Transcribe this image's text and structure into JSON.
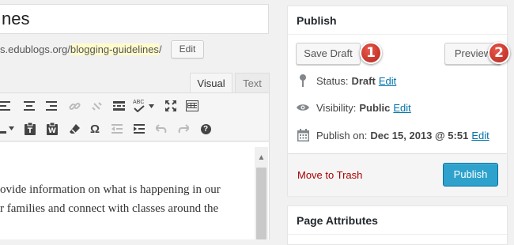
{
  "editor": {
    "title_value": "nes",
    "permalink_prefix": "s.edublogs.org/",
    "permalink_slug": "blogging-guidelines",
    "permalink_suffix": "/",
    "edit_slug_label": "Edit",
    "tabs": [
      {
        "label": "Visual",
        "active": true
      },
      {
        "label": "Text",
        "active": false
      }
    ],
    "toolbar_row1": [
      "align-left-icon",
      "align-center-icon",
      "align-right-icon",
      "link-icon",
      "unlink-icon",
      "read-more-icon",
      "spellcheck-icon",
      "fullscreen-icon",
      "kitchen-sink-icon"
    ],
    "toolbar_row2": [
      "text-color-icon",
      "paste-as-text-icon",
      "paste-from-word-icon",
      "clear-formatting-icon",
      "special-character-icon",
      "outdent-icon",
      "indent-icon",
      "undo-icon",
      "redo-icon",
      "help-icon"
    ],
    "special_char_glyph": "Ω",
    "spellcheck_glyph": "ABC",
    "help_glyph": "?",
    "body_lines": [
      "ovide information on what is happening in our",
      "r families and connect with classes around the"
    ]
  },
  "publish_box": {
    "title": "Publish",
    "save_draft_label": "Save Draft",
    "preview_label": "Preview",
    "badges": [
      "1",
      "2"
    ],
    "status_label": "Status:",
    "status_value": "Draft",
    "status_edit": "Edit",
    "visibility_label": "Visibility:",
    "visibility_value": "Public",
    "visibility_edit": "Edit",
    "publish_on_label": "Publish on:",
    "publish_on_value": "Dec 15, 2013 @ 5:51",
    "publish_on_edit": "Edit",
    "trash_label": "Move to Trash",
    "publish_label": "Publish"
  },
  "page_attributes": {
    "title": "Page Attributes"
  },
  "colors": {
    "accent": "#2ea2cc",
    "link": "#0073aa",
    "trash": "#aa0000",
    "badge": "#cc3a2e",
    "slug_highlight": "#fffbcc"
  }
}
